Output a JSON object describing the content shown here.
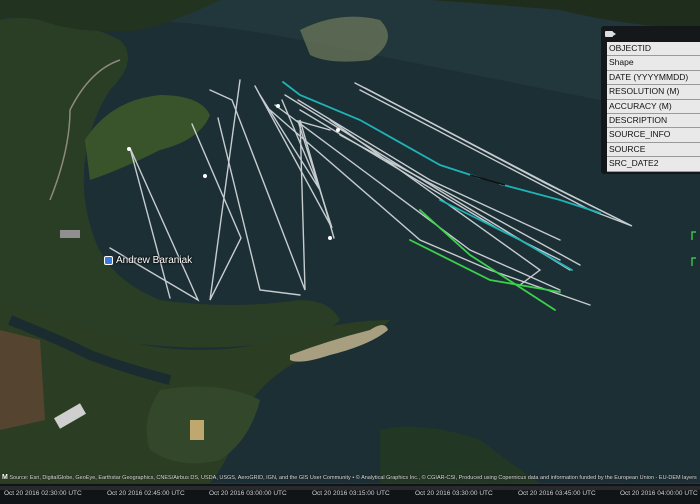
{
  "map": {
    "place_label": "Andrew Baraniak"
  },
  "attribute_panel": {
    "fields": [
      "OBJECTID",
      "Shape",
      "DATE (YYYYMMDD)",
      "RESOLUTION (M)",
      "ACCURACY (M)",
      "DESCRIPTION",
      "SOURCE_INFO",
      "SOURCE",
      "SRC_DATE2"
    ]
  },
  "credits": {
    "logo": "M",
    "text": "Source: Esri, DigitalGlobe, GeoEye, Earthstar Geographics, CNES/Airbus DS, USDA, USGS, AeroGRID, IGN, and the GIS User Community • © Analytical Graphics Inc., © CGIAR-CSI, Produced using Copernicus data and information funded by the European Union - EU-DEM layers"
  },
  "timeline": {
    "ticks": [
      "Oct 20 2016 02:30:00 UTC",
      "Oct 20 2016 02:45:00 UTC",
      "Oct 20 2016 03:00:00 UTC",
      "Oct 20 2016 03:15:00 UTC",
      "Oct 20 2016 03:30:00 UTC",
      "Oct 20 2016 03:45:00 UTC",
      "Oct 20 2016 04:00:00 UTC"
    ]
  },
  "colors": {
    "water": "#1b2f35",
    "forest": "#263a20",
    "track_white": "#d9dde0",
    "track_cyan": "#1fb3b7",
    "track_green": "#3bd24a"
  }
}
